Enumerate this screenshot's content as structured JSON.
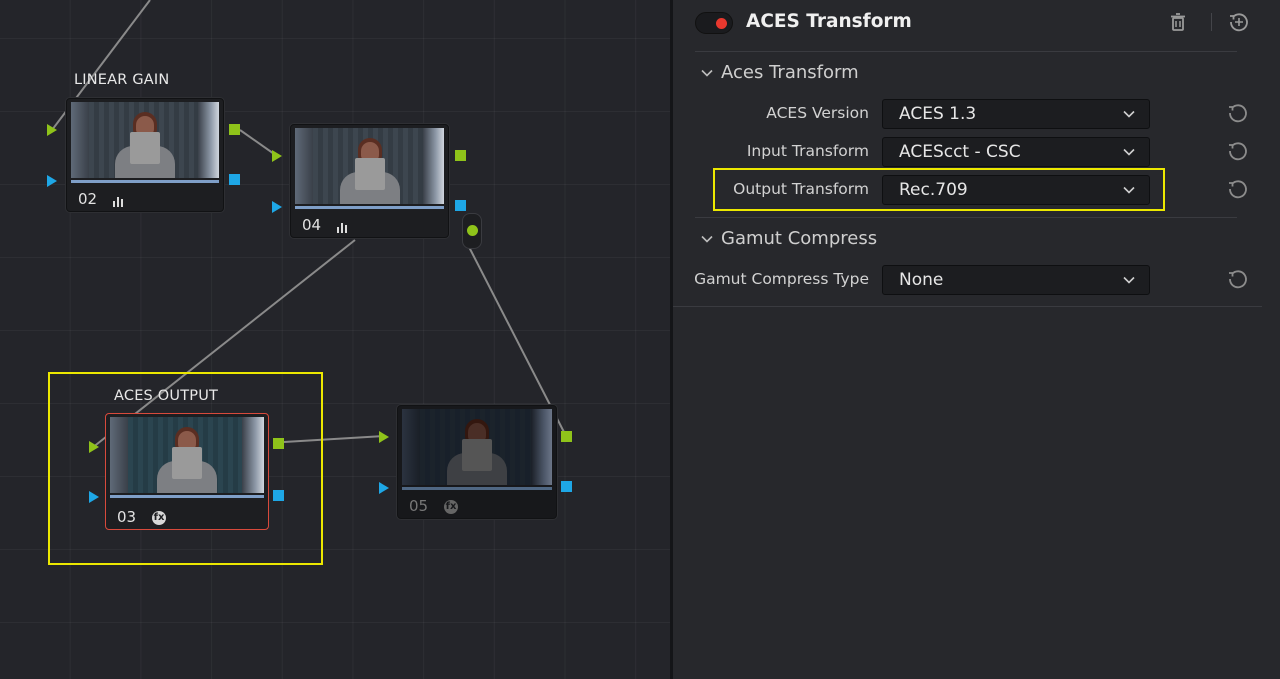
{
  "node_editor": {
    "nodes": [
      {
        "label": "LINEAR GAIN",
        "number": "02",
        "icon": "bars-icon"
      },
      {
        "label": "",
        "number": "04",
        "icon": "bars-icon"
      },
      {
        "label": "ACES OUTPUT",
        "number": "03",
        "icon": "fx-icon",
        "selected": true
      },
      {
        "label": "",
        "number": "05",
        "icon": "fx-icon",
        "disabled": true
      }
    ],
    "colors": {
      "rgb_port": "#8fc31a",
      "alpha_port": "#1ea7e6",
      "selection_border": "#d84a3c",
      "annotation": "#ece800"
    }
  },
  "inspector": {
    "title": "ACES Transform",
    "enabled": true,
    "sections": [
      {
        "name": "Aces Transform",
        "params": [
          {
            "label": "ACES Version",
            "value": "ACES 1.3"
          },
          {
            "label": "Input Transform",
            "value": "ACEScct - CSC"
          },
          {
            "label": "Output Transform",
            "value": "Rec.709",
            "highlighted": true
          }
        ]
      },
      {
        "name": "Gamut Compress",
        "params": [
          {
            "label": "Gamut Compress Type",
            "value": "None"
          }
        ]
      }
    ]
  }
}
